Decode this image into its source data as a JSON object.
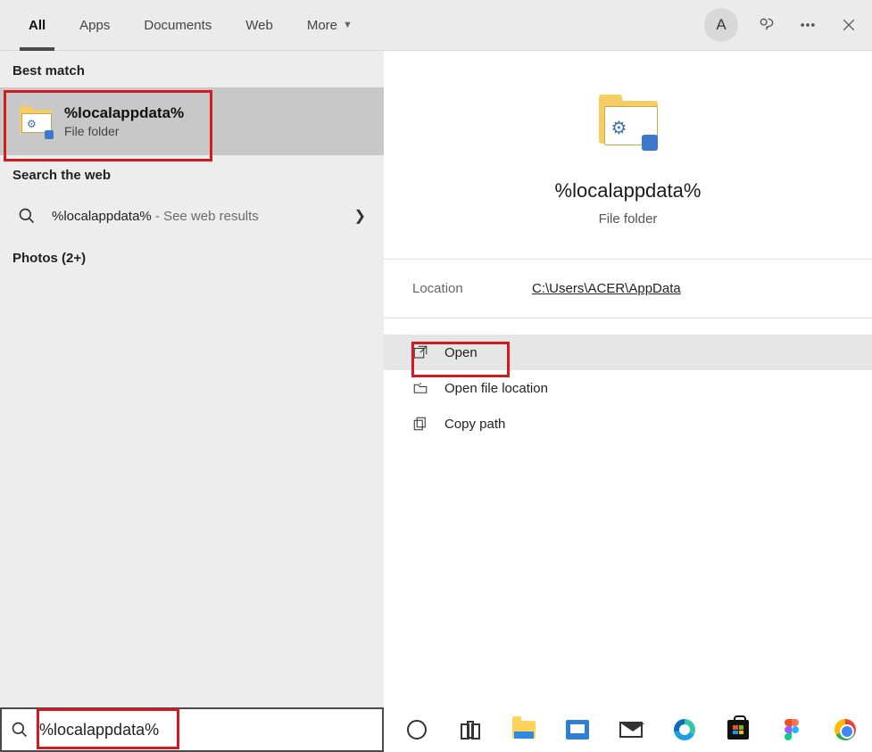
{
  "tabs": {
    "all": "All",
    "apps": "Apps",
    "documents": "Documents",
    "web": "Web",
    "more": "More"
  },
  "avatar_initial": "A",
  "left": {
    "best_match_header": "Best match",
    "best_title": "%localappdata%",
    "best_subtitle": "File folder",
    "web_header": "Search the web",
    "web_query": "%localappdata%",
    "web_suffix": " - See web results",
    "photos": "Photos (2+)"
  },
  "preview": {
    "title": "%localappdata%",
    "subtitle": "File folder",
    "location_label": "Location",
    "location_value": "C:\\Users\\ACER\\AppData",
    "actions": {
      "open": "Open",
      "open_location": "Open file location",
      "copy_path": "Copy path"
    }
  },
  "search_value": "%localappdata%"
}
